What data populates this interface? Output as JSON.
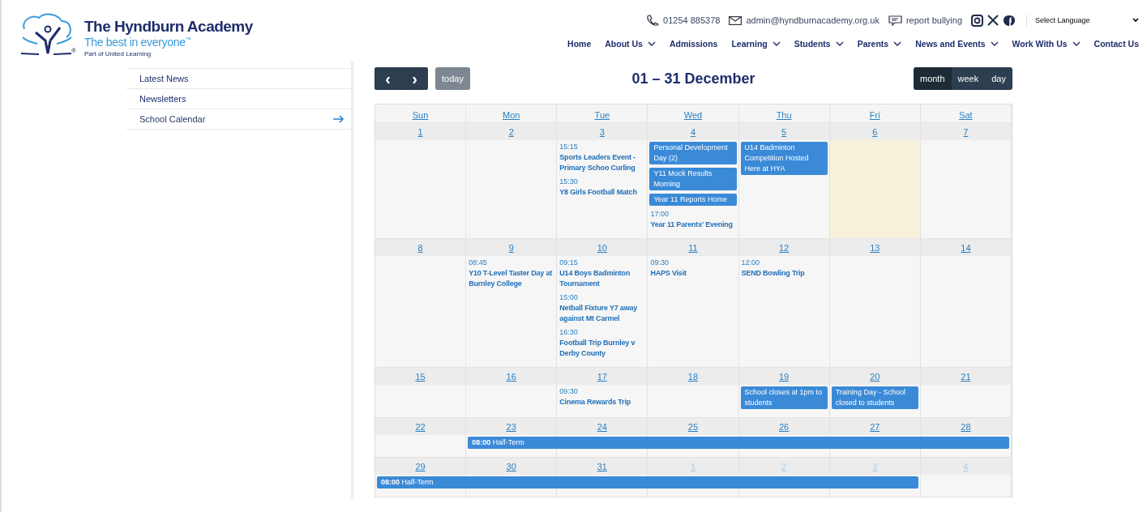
{
  "logo": {
    "name": "The Hyndburn Academy",
    "tagline": "The best in everyone",
    "tagline_mark": "™",
    "registered": "®",
    "group": "Part of United Learning"
  },
  "contact": {
    "phone": "01254 885378",
    "email": "admin@hyndburnacademy.org.uk",
    "report": "report bullying"
  },
  "language_select": {
    "value": "Select Language"
  },
  "nav": [
    {
      "label": "Home",
      "dropdown": false
    },
    {
      "label": "About Us",
      "dropdown": true
    },
    {
      "label": "Admissions",
      "dropdown": false
    },
    {
      "label": "Learning",
      "dropdown": true
    },
    {
      "label": "Students",
      "dropdown": true
    },
    {
      "label": "Parents",
      "dropdown": true
    },
    {
      "label": "News and Events",
      "dropdown": true
    },
    {
      "label": "Work With Us",
      "dropdown": true
    },
    {
      "label": "Contact Us",
      "dropdown": false
    }
  ],
  "sidebar": {
    "items": [
      {
        "label": "Latest News",
        "selected": false
      },
      {
        "label": "Newsletters",
        "selected": false
      },
      {
        "label": "School Calendar",
        "selected": true
      }
    ]
  },
  "calendar": {
    "title": "01 – 31 December",
    "today_button": "today",
    "prev": "‹",
    "next": "›",
    "views": [
      {
        "label": "month",
        "selected": true
      },
      {
        "label": "week",
        "selected": false
      },
      {
        "label": "day",
        "selected": false
      }
    ],
    "weekdays": [
      "Sun",
      "Mon",
      "Tue",
      "Wed",
      "Thu",
      "Fri",
      "Sat"
    ],
    "weeks": [
      {
        "days": [
          {
            "number": "1",
            "other_month": false,
            "today": false
          },
          {
            "number": "2",
            "other_month": false,
            "today": false
          },
          {
            "number": "3",
            "other_month": false,
            "today": false,
            "events": [
              {
                "kind": "timed",
                "time": "15:15",
                "title": "Sports Leaders Event - Primary Schoo Curling"
              },
              {
                "kind": "timed",
                "time": "15:30",
                "title": "Y8 Girls Football Match"
              }
            ]
          },
          {
            "number": "4",
            "other_month": false,
            "today": false,
            "events": [
              {
                "kind": "block",
                "title": "Personal Development Day (2)"
              },
              {
                "kind": "block",
                "title": "Y11 Mock Results Morning"
              },
              {
                "kind": "block",
                "title": "Year 11 Reports Home"
              },
              {
                "kind": "timed",
                "time": "17:00",
                "title": "Year 11 Parents' Evening"
              }
            ]
          },
          {
            "number": "5",
            "other_month": false,
            "today": false,
            "events": [
              {
                "kind": "block",
                "title": "U14 Badminton Competition Hosted Here at HYA"
              }
            ]
          },
          {
            "number": "6",
            "other_month": false,
            "today": true
          },
          {
            "number": "7",
            "other_month": false,
            "today": false
          }
        ]
      },
      {
        "days": [
          {
            "number": "8",
            "other_month": false,
            "today": false
          },
          {
            "number": "9",
            "other_month": false,
            "today": false,
            "events": [
              {
                "kind": "timed",
                "time": "08:45",
                "title": "Y10 T-Level Taster Day at Burnley College"
              }
            ]
          },
          {
            "number": "10",
            "other_month": false,
            "today": false,
            "events": [
              {
                "kind": "timed",
                "time": "09:15",
                "title": "U14 Boys Badminton Tournament"
              },
              {
                "kind": "timed",
                "time": "15:00",
                "title": "Netball Fixture Y7 away against Mt Carmel"
              },
              {
                "kind": "timed",
                "time": "16:30",
                "title": "Football Trip Burnley v Derby County"
              }
            ]
          },
          {
            "number": "11",
            "other_month": false,
            "today": false,
            "events": [
              {
                "kind": "timed",
                "time": "09:30",
                "title": "HAPS Visit"
              }
            ]
          },
          {
            "number": "12",
            "other_month": false,
            "today": false,
            "events": [
              {
                "kind": "timed",
                "time": "12:00",
                "title": "SEND Bowling Trip"
              }
            ]
          },
          {
            "number": "13",
            "other_month": false,
            "today": false
          },
          {
            "number": "14",
            "other_month": false,
            "today": false
          }
        ]
      },
      {
        "days": [
          {
            "number": "15",
            "other_month": false,
            "today": false
          },
          {
            "number": "16",
            "other_month": false,
            "today": false
          },
          {
            "number": "17",
            "other_month": false,
            "today": false,
            "events": [
              {
                "kind": "timed",
                "time": "09:30",
                "title": "Cinema Rewards Trip"
              }
            ]
          },
          {
            "number": "18",
            "other_month": false,
            "today": false
          },
          {
            "number": "19",
            "other_month": false,
            "today": false,
            "events": [
              {
                "kind": "block",
                "title": "School closes at 1pm to students"
              }
            ]
          },
          {
            "number": "20",
            "other_month": false,
            "today": false,
            "events": [
              {
                "kind": "block",
                "title": "Training Day - School closed to students"
              }
            ]
          },
          {
            "number": "21",
            "other_month": false,
            "today": false
          }
        ]
      },
      {
        "days": [
          {
            "number": "22",
            "other_month": false,
            "today": false,
            "in_span": false
          },
          {
            "number": "23",
            "other_month": false,
            "today": false,
            "in_span": true
          },
          {
            "number": "24",
            "other_month": false,
            "today": false,
            "in_span": true
          },
          {
            "number": "25",
            "other_month": false,
            "today": false,
            "in_span": true
          },
          {
            "number": "26",
            "other_month": false,
            "today": false,
            "in_span": true
          },
          {
            "number": "27",
            "other_month": false,
            "today": false,
            "in_span": true
          },
          {
            "number": "28",
            "other_month": false,
            "today": false,
            "in_span": true
          }
        ],
        "span": {
          "time": "08:00",
          "title": "Half-Term"
        }
      },
      {
        "days": [
          {
            "number": "29",
            "other_month": false,
            "today": false,
            "in_span": true
          },
          {
            "number": "30",
            "other_month": false,
            "today": false,
            "in_span": true
          },
          {
            "number": "31",
            "other_month": false,
            "today": false,
            "in_span": true
          },
          {
            "number": "1",
            "other_month": true,
            "today": false,
            "in_span": true
          },
          {
            "number": "2",
            "other_month": true,
            "today": false,
            "in_span": true
          },
          {
            "number": "3",
            "other_month": true,
            "today": false,
            "in_span": true
          },
          {
            "number": "4",
            "other_month": true,
            "today": false,
            "in_span": false
          }
        ],
        "span": {
          "time": "08:00",
          "title": "Half-Term"
        }
      }
    ]
  }
}
